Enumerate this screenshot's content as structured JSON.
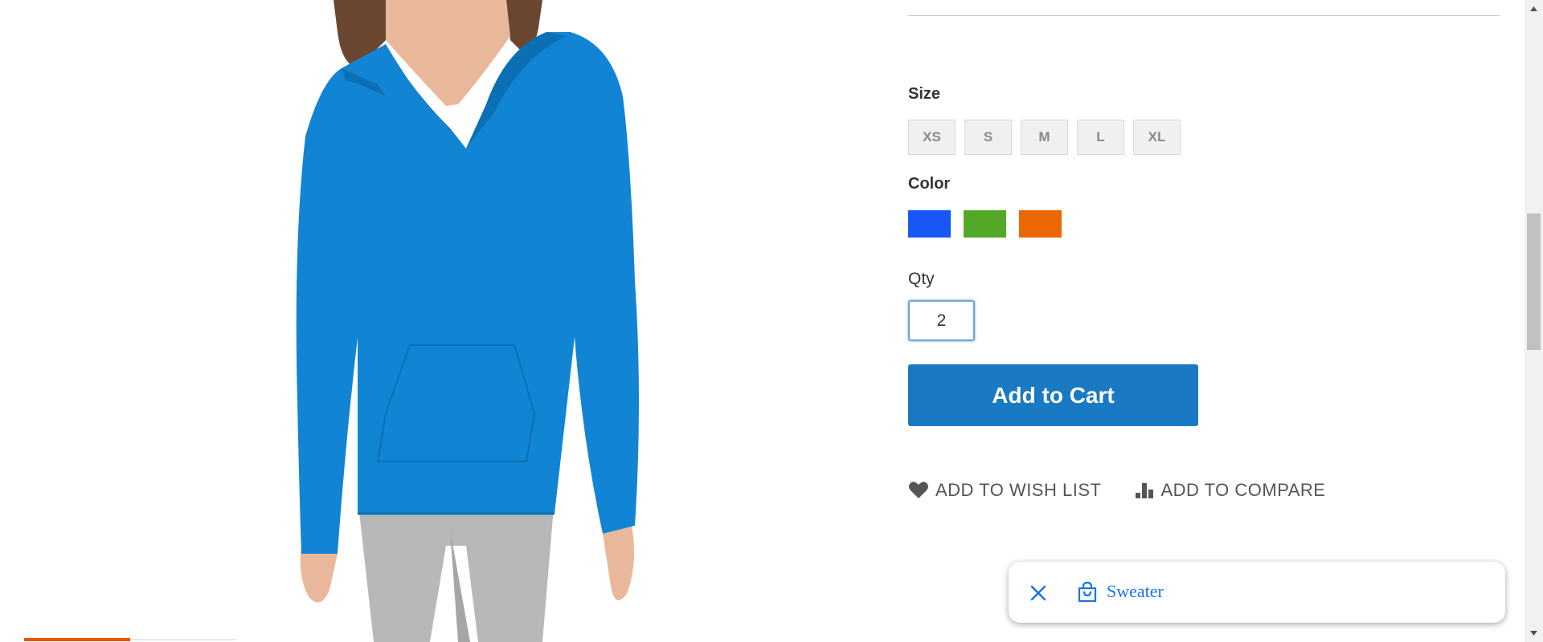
{
  "product": {
    "image_alt": "Blue long-sleeve hooded v-neck top on model"
  },
  "options": {
    "size_label": "Size",
    "sizes": [
      "XS",
      "S",
      "M",
      "L",
      "XL"
    ],
    "color_label": "Color",
    "colors": [
      {
        "name": "Blue",
        "hex": "#1857f7"
      },
      {
        "name": "Green",
        "hex": "#53a828"
      },
      {
        "name": "Orange",
        "hex": "#eb6703"
      }
    ]
  },
  "quantity": {
    "label": "Qty",
    "value": "2"
  },
  "cart": {
    "add_label": "Add to Cart"
  },
  "actions": {
    "wishlist_label": "ADD TO WISH LIST",
    "compare_label": "ADD TO COMPARE"
  },
  "toast": {
    "text": "Sweater"
  },
  "colors": {
    "accent": "#1979c3",
    "brand_orange": "#eb5202",
    "link_blue": "#1a73e8"
  }
}
